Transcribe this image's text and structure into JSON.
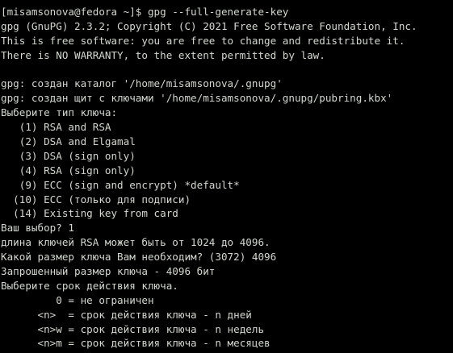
{
  "terminal": {
    "lines": [
      "[misamsonova@fedora ~]$ gpg --full-generate-key",
      "gpg (GnuPG) 2.3.2; Copyright (C) 2021 Free Software Foundation, Inc.",
      "This is free software: you are free to change and redistribute it.",
      "There is NO WARRANTY, to the extent permitted by law.",
      "",
      "gpg: создан каталог '/home/misamsonova/.gnupg'",
      "gpg: создан щит с ключами '/home/misamsonova/.gnupg/pubring.kbx'",
      "Выберите тип ключа:",
      "   (1) RSA and RSA",
      "   (2) DSA and Elgamal",
      "   (3) DSA (sign only)",
      "   (4) RSA (sign only)",
      "   (9) ECC (sign and encrypt) *default*",
      "  (10) ECC (только для подписи)",
      "  (14) Existing key from card",
      "Ваш выбор? 1",
      "длина ключей RSA может быть от 1024 до 4096.",
      "Какой размер ключа Вам необходим? (3072) 4096",
      "Запрошенный размер ключа - 4096 бит",
      "Выберите срок действия ключа.",
      "         0 = не ограничен",
      "      <n>  = срок действия ключа - n дней",
      "      <n>w = срок действия ключа - n недель",
      "      <n>m = срок действия ключа - n месяцев"
    ]
  }
}
